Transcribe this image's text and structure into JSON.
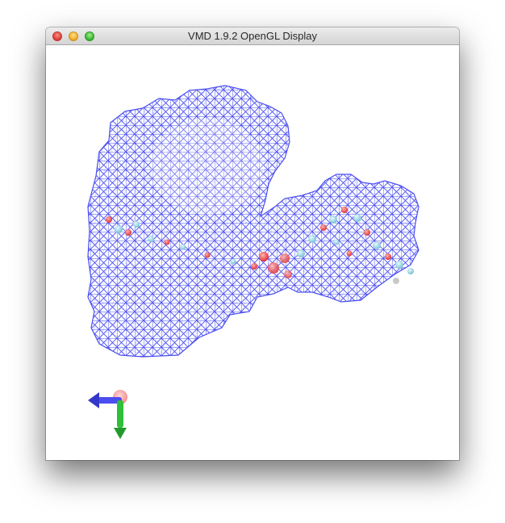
{
  "window": {
    "title": "VMD 1.9.2 OpenGL Display",
    "controls": [
      "close",
      "minimize",
      "zoom"
    ]
  },
  "display": {
    "background": "#ffffff",
    "mesh_color": "#4a4ef0",
    "atom_colors": [
      "#e84a4a",
      "#9fd3e0",
      "#c8c8c8"
    ],
    "axes_colors": {
      "x": "#4a4ef0",
      "y": "#2fbf3a",
      "z": "#f06a6a"
    }
  }
}
